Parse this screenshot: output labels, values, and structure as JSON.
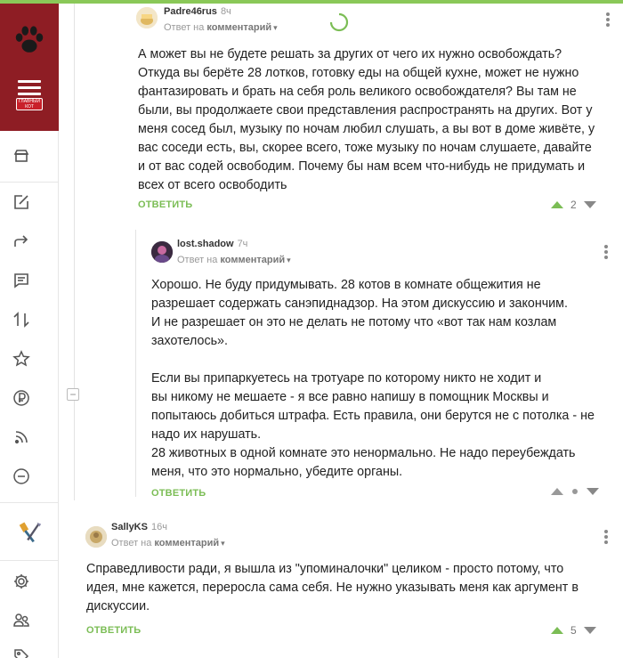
{
  "colors": {
    "accent_green": "#7bbd55",
    "sidebar_brand": "#8e1d24",
    "top_bar": "#8ac858"
  },
  "sidebar": {
    "logo_badge_text": "ГЛАВНЫЙ КОТ СООБЩЕСТВА",
    "items": [
      {
        "icon": "home-icon"
      },
      {
        "icon": "edit-icon"
      },
      {
        "icon": "share-icon"
      },
      {
        "icon": "comments-icon"
      },
      {
        "icon": "sort-icon"
      },
      {
        "icon": "star-icon"
      },
      {
        "icon": "ruble-icon"
      },
      {
        "icon": "rss-icon"
      },
      {
        "icon": "minus-circle-icon"
      },
      {
        "icon": "paint-tools-icon"
      },
      {
        "icon": "settings-icon"
      },
      {
        "icon": "users-icon"
      },
      {
        "icon": "tag-icon"
      }
    ]
  },
  "comments": [
    {
      "author": "Padre46rus",
      "time": "8ч",
      "reply_prefix": "Ответ на",
      "reply_target": "комментарий",
      "text": [
        "А может вы не будете решать за других от чего их нужно освобождать?",
        "Откуда вы берёте 28 лотков, готовку еды на общей кухне, может не нужно",
        "фантазировать и брать на себя роль великого освобождателя? Вы там не",
        "были, вы продолжаете свои представления распространять на других. Вот у",
        "меня сосед был, музыку по ночам любил слушать, а вы вот в доме живёте, у",
        "вас соседи есть, вы, скорее всего, тоже музыку по ночам слушаете, давайте",
        "и от вас содей освободим. Почему бы нам всем что-нибудь не придумать и",
        "всех от всего освободить"
      ],
      "reply_label": "ОТВЕТИТЬ",
      "rating": "2"
    },
    {
      "author": "lost.shadow",
      "time": "7ч",
      "reply_prefix": "Ответ на",
      "reply_target": "комментарий",
      "text": [
        "Хорошо. Не буду придумывать. 28 котов в комнате общежития не",
        "разрешает содержать санэпиднадзор. На этом дискуссию и закончим.",
        "И не разрешает он это не делать не потому что «вот так нам козлам",
        "захотелось».",
        "",
        "Если вы припаркуетесь на тротуаре по которому никто не ходит и",
        "вы никому не мешаете - я все равно напишу в помощник Москвы и",
        "попытаюсь добиться штрафа. Есть правила, они берутся не с потолка - не",
        "надо их нарушать.",
        "28 животных в одной комнате это ненормально. Не надо переубеждать",
        "меня, что это нормально, убедите органы."
      ],
      "reply_label": "ОТВЕТИТЬ",
      "rating": ""
    },
    {
      "author": "SallyKS",
      "time": "16ч",
      "reply_prefix": "Ответ на",
      "reply_target": "комментарий",
      "text": [
        "Справедливости ради, я вышла из \"упоминалочки\" целиком - просто потому, что",
        "идея, мне кажется, переросла сама себя. Не нужно указывать меня как аргумент в",
        "дискуссии."
      ],
      "reply_label": "ОТВЕТИТЬ",
      "rating": "5"
    }
  ]
}
